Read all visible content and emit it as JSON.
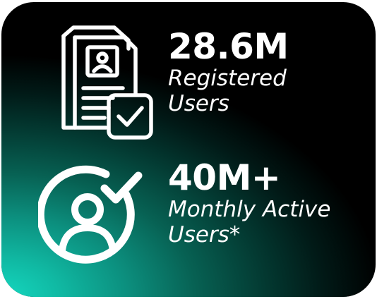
{
  "stats": [
    {
      "value": "28.6M",
      "label_lines": [
        "Registered",
        "Users"
      ],
      "icon": "registration-document-checkmark-icon"
    },
    {
      "value": "40M+",
      "label_lines": [
        "Monthly Active",
        "Users*"
      ],
      "icon": "user-checkmark-icon"
    }
  ],
  "colors": {
    "background": "#000000",
    "gradient_accent": "#15d8c0",
    "text": "#ffffff"
  }
}
